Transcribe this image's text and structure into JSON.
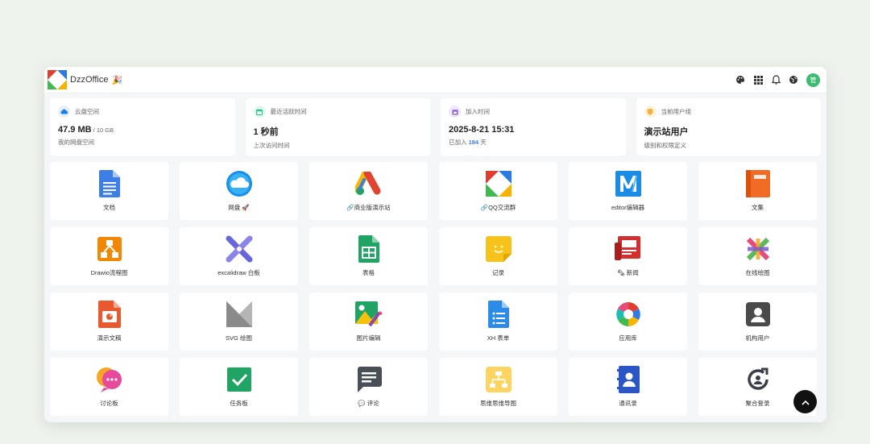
{
  "header": {
    "app_name": "DzzOffice",
    "spark": "🎉",
    "avatar_text": "管",
    "actions": [
      "palette-icon",
      "apps-grid-icon",
      "bell-icon",
      "globe-icon"
    ]
  },
  "stats": [
    {
      "label": "云盘空间",
      "value": "47.9 MB",
      "value_suffix": " / 10 GB",
      "sub": "我的网盘空间",
      "icon": "cloud-icon",
      "color": "#1f7ee8"
    },
    {
      "label": "最近活跃时间",
      "value": "1 秒前",
      "sub": "上次访问时间",
      "icon": "calendar-icon",
      "color": "#2ec28b"
    },
    {
      "label": "加入时间",
      "value": "2025-8-21 15:31",
      "sub_prefix": "已加入 ",
      "sub_num": "184",
      "sub_suffix": " 天",
      "icon": "calendar-plus-icon",
      "color": "#8a5ad8"
    },
    {
      "label": "当前用户组",
      "value": "演示站用户",
      "sub": "级别和权限定义",
      "icon": "shield-icon",
      "color": "#f2b23c"
    }
  ],
  "apps": [
    {
      "label": "文档",
      "icon": "docs-icon"
    },
    {
      "label": "网盘 🚀",
      "icon": "cloud-drive-icon"
    },
    {
      "label": "🔗商业版演示站",
      "icon": "ads-logo-icon"
    },
    {
      "label": "🔗QQ交流群",
      "icon": "dzz-logo-icon"
    },
    {
      "label": "editor编辑器",
      "icon": "editor-m-icon"
    },
    {
      "label": "文集",
      "icon": "book-icon"
    },
    {
      "label": "Drawio流程图",
      "icon": "flowchart-icon"
    },
    {
      "label": "excalidraw 白板",
      "icon": "whiteboard-icon"
    },
    {
      "label": "表格",
      "icon": "sheets-icon"
    },
    {
      "label": "记录",
      "icon": "note-icon"
    },
    {
      "label": "🗞 新闻",
      "icon": "news-icon"
    },
    {
      "label": "在线绘图",
      "icon": "drawing-icon"
    },
    {
      "label": "演示文稿",
      "icon": "slides-icon"
    },
    {
      "label": "SVG 绘图",
      "icon": "svg-icon"
    },
    {
      "label": "图片编辑",
      "icon": "image-edit-icon"
    },
    {
      "label": "XH 表单",
      "icon": "form-icon"
    },
    {
      "label": "应用库",
      "icon": "app-store-icon"
    },
    {
      "label": "机构用户",
      "icon": "org-user-icon"
    },
    {
      "label": "讨论板",
      "icon": "chat-bubble-icon"
    },
    {
      "label": "任务板",
      "icon": "task-check-icon"
    },
    {
      "label": "💬 评论",
      "icon": "comment-icon"
    },
    {
      "label": "思维思维导图",
      "icon": "mindmap-icon"
    },
    {
      "label": "通讯录",
      "icon": "contacts-icon"
    },
    {
      "label": "聚合登录",
      "icon": "login-icon"
    }
  ],
  "scroll_top": "chevron-up-icon"
}
